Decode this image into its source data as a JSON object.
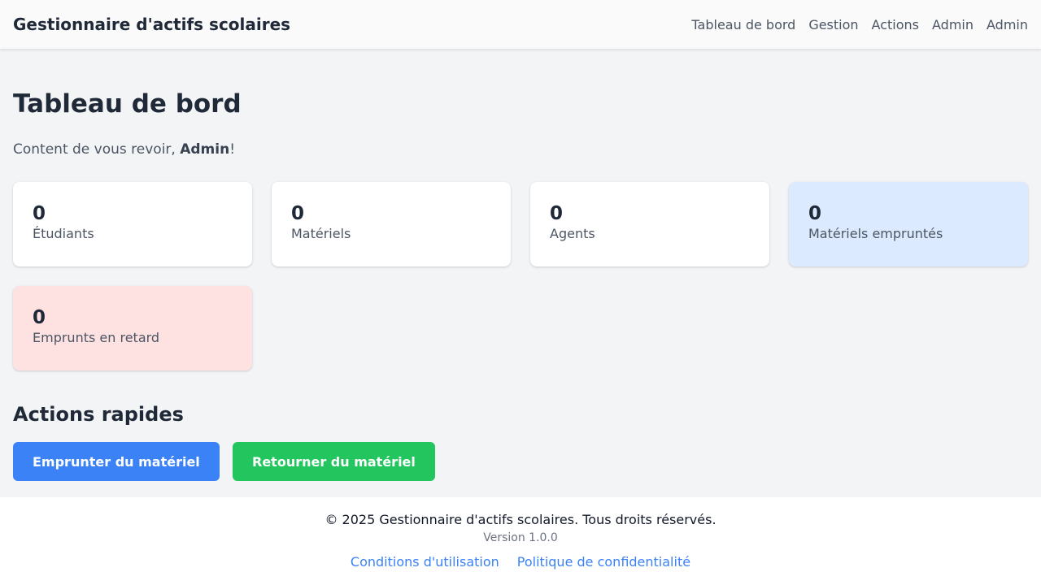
{
  "navbar": {
    "brand": "Gestionnaire d'actifs scolaires",
    "links": [
      "Tableau de bord",
      "Gestion",
      "Actions",
      "Admin",
      "Admin"
    ]
  },
  "main": {
    "title": "Tableau de bord",
    "welcome_prefix": "Content de vous revoir, ",
    "welcome_user": "Admin",
    "welcome_suffix": "!"
  },
  "stats": [
    {
      "value": "0",
      "label": "Étudiants"
    },
    {
      "value": "0",
      "label": "Matériels"
    },
    {
      "value": "0",
      "label": "Agents"
    },
    {
      "value": "0",
      "label": "Matériels empruntés",
      "color": "#dbeafe"
    },
    {
      "value": "0",
      "label": "Emprunts en retard",
      "color": "#fee2e2"
    }
  ],
  "quick_actions": {
    "title": "Actions rapides",
    "borrow_label": "Emprunter du matériel",
    "return_label": "Retourner du matériel",
    "borrow_color": "#3b82f6",
    "return_color": "#22c55e"
  },
  "footer": {
    "copyright": "© 2025 Gestionnaire d'actifs scolaires. Tous droits réservés.",
    "version": "Version 1.0.0",
    "terms_label": "Conditions d'utilisation",
    "privacy_label": "Politique de confidentialité"
  }
}
